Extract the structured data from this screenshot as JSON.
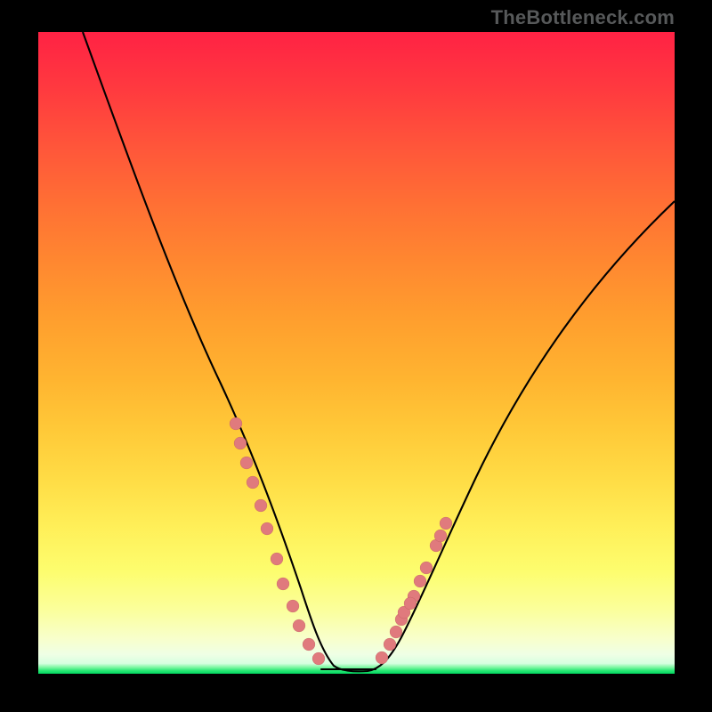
{
  "attribution": "TheBottleneck.com",
  "colors": {
    "gradient_top": "#ff2244",
    "gradient_bottom": "#00d760",
    "curve": "#000000",
    "marker": "#e07a7d",
    "frame": "#000000"
  },
  "chart_data": {
    "type": "line",
    "title": "",
    "xlabel": "",
    "ylabel": "",
    "xlim": [
      0,
      100
    ],
    "ylim": [
      0,
      100
    ],
    "series": [
      {
        "name": "bottleneck-curve",
        "x": [
          7,
          12,
          18,
          24,
          28.5,
          31.5,
          34,
          36.2,
          38,
          39.6,
          41,
          42.4,
          43.8,
          45,
          46.3,
          48,
          50,
          52,
          54,
          56,
          58,
          61,
          65,
          70,
          76,
          83,
          90,
          97,
          100
        ],
        "y": [
          100,
          88,
          74,
          59,
          47,
          38,
          30,
          23,
          17,
          12,
          8,
          4.5,
          2,
          0.8,
          0.2,
          0.1,
          0.1,
          0.1,
          1,
          3,
          7,
          13,
          22,
          32,
          43,
          54,
          63,
          71,
          74
        ]
      }
    ],
    "markers": {
      "left_cluster": [
        [
          31.0,
          39
        ],
        [
          31.8,
          36
        ],
        [
          32.8,
          33
        ],
        [
          33.8,
          30
        ],
        [
          35.0,
          26
        ],
        [
          36.0,
          22.5
        ],
        [
          37.5,
          18
        ],
        [
          38.5,
          14
        ],
        [
          40.0,
          10.5
        ],
        [
          41.0,
          7.5
        ],
        [
          42.5,
          4.5
        ],
        [
          44.0,
          2.2
        ]
      ],
      "right_cluster": [
        [
          54.0,
          2.5
        ],
        [
          55.2,
          4.5
        ],
        [
          56.2,
          6.5
        ],
        [
          57.0,
          8.5
        ],
        [
          57.5,
          9.5
        ],
        [
          59.0,
          12
        ],
        [
          58.5,
          11
        ],
        [
          60.0,
          14.5
        ],
        [
          61.0,
          16.5
        ],
        [
          62.5,
          20
        ],
        [
          63.2,
          21.5
        ],
        [
          64.0,
          23.5
        ]
      ],
      "flat_segment": {
        "x0": 44.5,
        "x1": 53.0,
        "y": 0.6
      }
    },
    "annotations": []
  }
}
